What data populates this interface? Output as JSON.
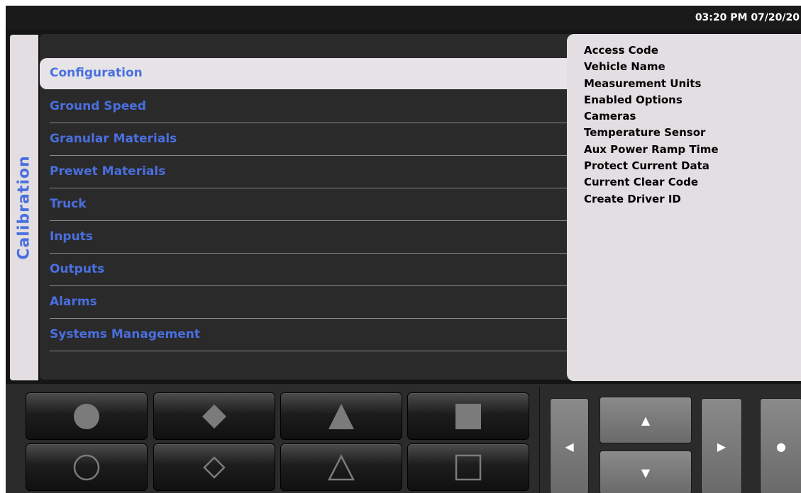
{
  "header": {
    "clock": "03:20 PM 07/20/20"
  },
  "sidebar": {
    "title": "Calibration"
  },
  "menu": {
    "items": [
      {
        "label": "Configuration",
        "selected": true
      },
      {
        "label": "Ground Speed"
      },
      {
        "label": "Granular Materials"
      },
      {
        "label": "Prewet Materials"
      },
      {
        "label": "Truck"
      },
      {
        "label": "Inputs"
      },
      {
        "label": "Outputs"
      },
      {
        "label": "Alarms"
      },
      {
        "label": "Systems Management"
      }
    ]
  },
  "submenu": {
    "items": [
      "Access Code",
      "Vehicle Name",
      "Measurement Units",
      "Enabled Options",
      "Cameras",
      "Temperature Sensor",
      "Aux Power Ramp Time",
      "Protect Current Data",
      "Current Clear Code",
      "Create Driver ID"
    ]
  },
  "controls": {
    "shape_buttons_top": [
      "filled-circle-icon",
      "filled-diamond-icon",
      "filled-triangle-icon",
      "filled-square-icon"
    ],
    "shape_buttons_bottom": [
      "outline-circle-icon",
      "outline-diamond-icon",
      "outline-triangle-icon",
      "outline-square-icon"
    ],
    "nav": {
      "left": "◀",
      "up": "▲",
      "down": "▼",
      "right": "▶",
      "select": "●"
    }
  },
  "colors": {
    "menu_text": "#4a6fe0",
    "panel_light": "#e2dee2",
    "background": "#000000"
  }
}
